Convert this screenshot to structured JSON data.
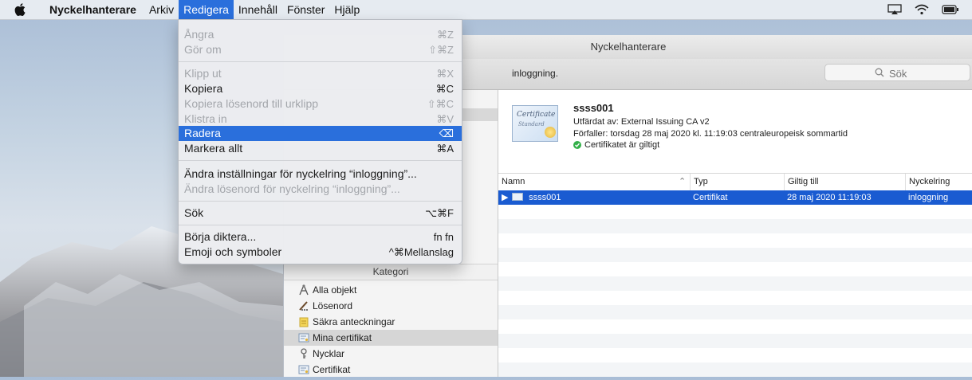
{
  "menubar": {
    "app_name": "Nyckelhanterare",
    "menus": [
      "Arkiv",
      "Redigera",
      "Innehåll",
      "Fönster",
      "Hjälp"
    ]
  },
  "window": {
    "title": "Nyckelhanterare",
    "toolbar_message": "inloggning.",
    "search_placeholder": "Sök"
  },
  "edit_menu": {
    "items": [
      {
        "label": "Ångra",
        "shortcut": "⌘Z"
      },
      {
        "label": "Gör om",
        "shortcut": "⇧⌘Z"
      },
      {
        "label": "Klipp ut",
        "shortcut": "⌘X"
      },
      {
        "label": "Kopiera",
        "shortcut": "⌘C"
      },
      {
        "label": "Kopiera lösenord till urklipp",
        "shortcut": "⇧⌘C"
      },
      {
        "label": "Klistra in",
        "shortcut": "⌘V"
      },
      {
        "label": "Radera",
        "shortcut": "⌫"
      },
      {
        "label": "Markera allt",
        "shortcut": "⌘A"
      },
      {
        "label": "Ändra inställningar för nyckelring “inloggning”...",
        "shortcut": ""
      },
      {
        "label": "Ändra lösenord för nyckelring “inloggning”...",
        "shortcut": ""
      },
      {
        "label": "Sök",
        "shortcut": "⌥⌘F"
      },
      {
        "label": "Börja diktera...",
        "shortcut": "fn fn"
      },
      {
        "label": "Emoji och symboler",
        "shortcut": "^⌘Mellanslag"
      }
    ]
  },
  "sidebar": {
    "category_header": "Kategori",
    "categories": [
      {
        "label": "Alla objekt",
        "icon": "all-items-icon"
      },
      {
        "label": "Lösenord",
        "icon": "password-icon"
      },
      {
        "label": "Säkra anteckningar",
        "icon": "secure-note-icon"
      },
      {
        "label": "Mina certifikat",
        "icon": "my-certificate-icon"
      },
      {
        "label": "Nycklar",
        "icon": "key-icon"
      },
      {
        "label": "Certifikat",
        "icon": "certificate-icon"
      }
    ]
  },
  "detail": {
    "name": "ssss001",
    "issued_by": "Utfärdat av: External Issuing CA v2",
    "expires": "Förfaller: torsdag 28 maj 2020 kl. 11:19:03 centraleuropeisk sommartid",
    "validity": "Certifikatet är giltigt",
    "cert_image_text_1": "Certificate",
    "cert_image_text_2": "Standard"
  },
  "table": {
    "columns": [
      "Namn",
      "Typ",
      "Giltig till",
      "Nyckelring"
    ],
    "rows": [
      {
        "name": "ssss001",
        "type": "Certifikat",
        "valid_until": "28 maj 2020 11:19:03",
        "keychain": "inloggning"
      }
    ]
  },
  "colors": {
    "accent": "#2a6fdc",
    "selection": "#1a5bd1",
    "valid": "#34b04a"
  }
}
